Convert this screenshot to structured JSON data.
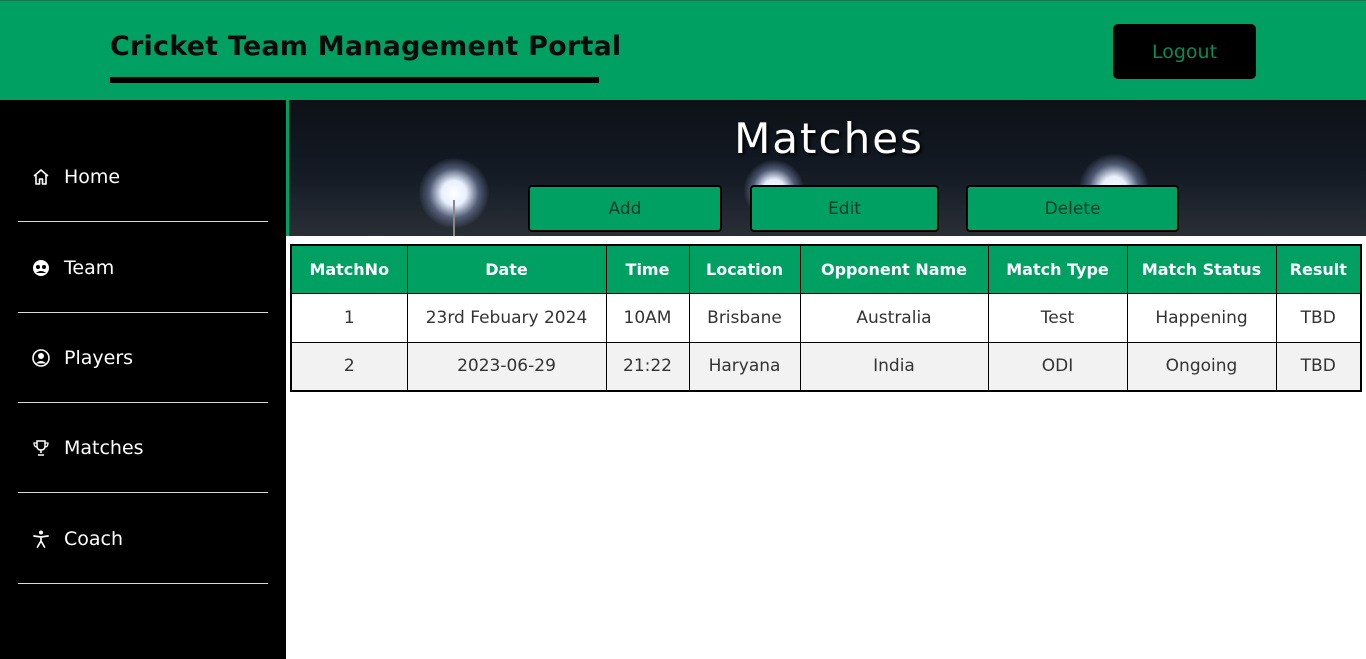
{
  "header": {
    "title": "Cricket Team Management Portal",
    "logout_label": "Logout"
  },
  "sidebar": {
    "items": [
      {
        "label": "Home",
        "icon": "home-icon"
      },
      {
        "label": "Team",
        "icon": "team-icon"
      },
      {
        "label": "Players",
        "icon": "player-icon"
      },
      {
        "label": "Matches",
        "icon": "trophy-icon"
      },
      {
        "label": "Coach",
        "icon": "coach-icon"
      }
    ]
  },
  "main": {
    "title": "Matches",
    "actions": {
      "add": "Add",
      "edit": "Edit",
      "delete": "Delete"
    },
    "table": {
      "columns": [
        "MatchNo",
        "Date",
        "Time",
        "Location",
        "Opponent Name",
        "Match Type",
        "Match Status",
        "Result"
      ],
      "rows": [
        [
          "1",
          "23rd Febuary 2024",
          "10AM",
          "Brisbane",
          "Australia",
          "Test",
          "Happening",
          "TBD"
        ],
        [
          "2",
          "2023-06-29",
          "21:22",
          "Haryana",
          "India",
          "ODI",
          "Ongoing",
          "TBD"
        ]
      ]
    }
  },
  "colors": {
    "accent": "#00a063",
    "sidebar_bg": "#000000",
    "header_bg": "#00a063"
  }
}
